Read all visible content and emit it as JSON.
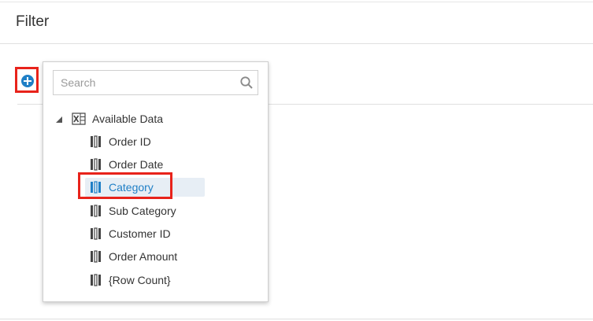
{
  "header": {
    "title": "Filter"
  },
  "add_button": {
    "icon": "plus-circle-icon",
    "color": "#1f7fc6"
  },
  "popup": {
    "search": {
      "placeholder": "Search",
      "value": ""
    },
    "tree": {
      "root_label": "Available Data",
      "items": [
        {
          "label": "Order ID",
          "selected": false
        },
        {
          "label": "Order Date",
          "selected": false
        },
        {
          "label": "Category",
          "selected": true
        },
        {
          "label": "Sub Category",
          "selected": false
        },
        {
          "label": "Customer ID",
          "selected": false
        },
        {
          "label": "Order Amount",
          "selected": false
        },
        {
          "label": "{Row Count}",
          "selected": false
        }
      ]
    }
  },
  "colors": {
    "accent": "#1f7fc6",
    "highlight_border": "#e8231b",
    "selected_bg": "#e7eef5"
  }
}
